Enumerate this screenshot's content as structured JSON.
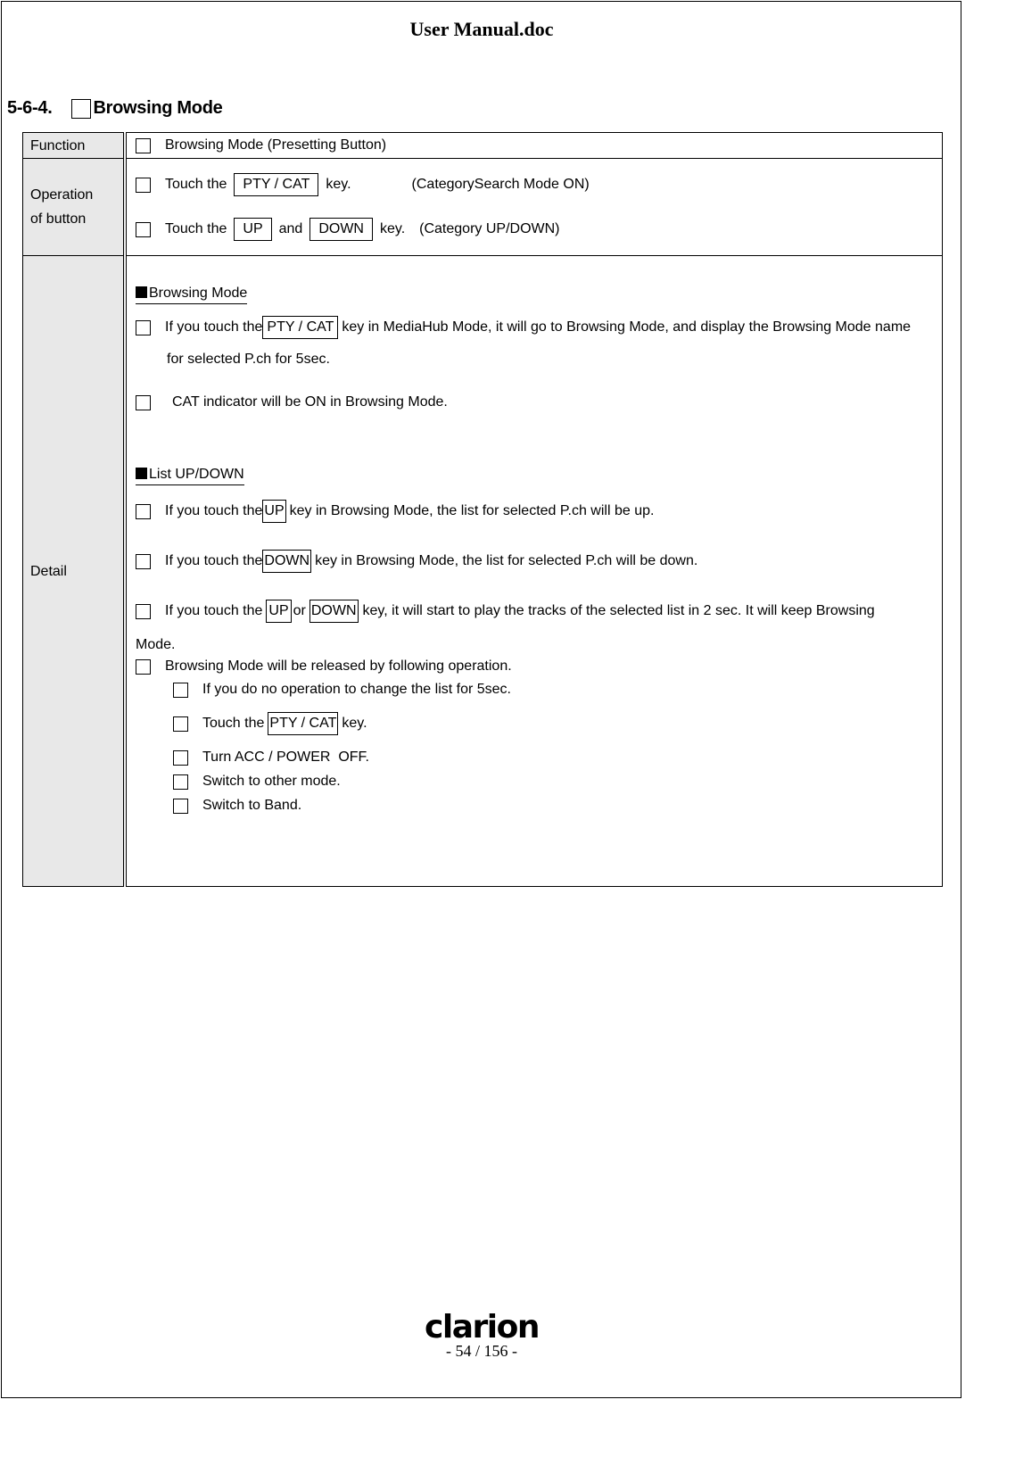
{
  "document": {
    "title": "User Manual.doc",
    "section_number": "5-6-4.",
    "section_title": "Browsing Mode",
    "brand_logo": "clarion",
    "page_indicator": "- 54 / 156 -"
  },
  "table": {
    "function": {
      "label": "Function",
      "text": "Browsing Mode (Presetting Button)"
    },
    "operation": {
      "label_line1": "Operation",
      "label_line2": "of button",
      "items": [
        {
          "pre": "Touch the",
          "key": "PTY / CAT",
          "post": "key.",
          "note": "(CategorySearch Mode ON)"
        },
        {
          "pre": "Touch the",
          "key1": "UP",
          "mid": "and",
          "key2": "DOWN",
          "post": "key.",
          "note": "(Category UP/DOWN)"
        }
      ]
    },
    "detail": {
      "label": "Detail",
      "browsing_heading": "Browsing  Mode",
      "browsing_items": [
        {
          "pre": "If you touch the",
          "key": "PTY / CAT",
          "post": "key in MediaHub Mode, it will go to Browsing Mode, and display the Browsing Mode name",
          "cont": "for selected P.ch for 5sec."
        },
        {
          "text": "CAT indicator will be ON in Browsing Mode."
        }
      ],
      "list_heading": "List UP/DOWN",
      "list_items": [
        {
          "pre": "If you touch the",
          "key": "UP",
          "post": "key in Browsing Mode, the list for selected P.ch will be up."
        },
        {
          "pre": "If you touch the",
          "key": "DOWN",
          "post": "key in Browsing Mode, the list for selected P.ch will be down."
        },
        {
          "pre": "If you touch the",
          "key1": "UP",
          "mid": "or",
          "key2": "DOWN",
          "post": "key, it will start to play the tracks of the selected list in 2 sec. It will keep Browsing",
          "cont": "Mode."
        }
      ],
      "release_heading": "Browsing Mode will be released by following operation.",
      "release_items": [
        {
          "text": "If you do no operation to change the list for 5sec."
        },
        {
          "pre": "Touch the",
          "key": "PTY / CAT",
          "post": "key."
        },
        {
          "text": "Turn ACC / POWER  OFF."
        },
        {
          "text": "Switch to other mode."
        },
        {
          "text": "Switch to Band."
        }
      ]
    }
  }
}
